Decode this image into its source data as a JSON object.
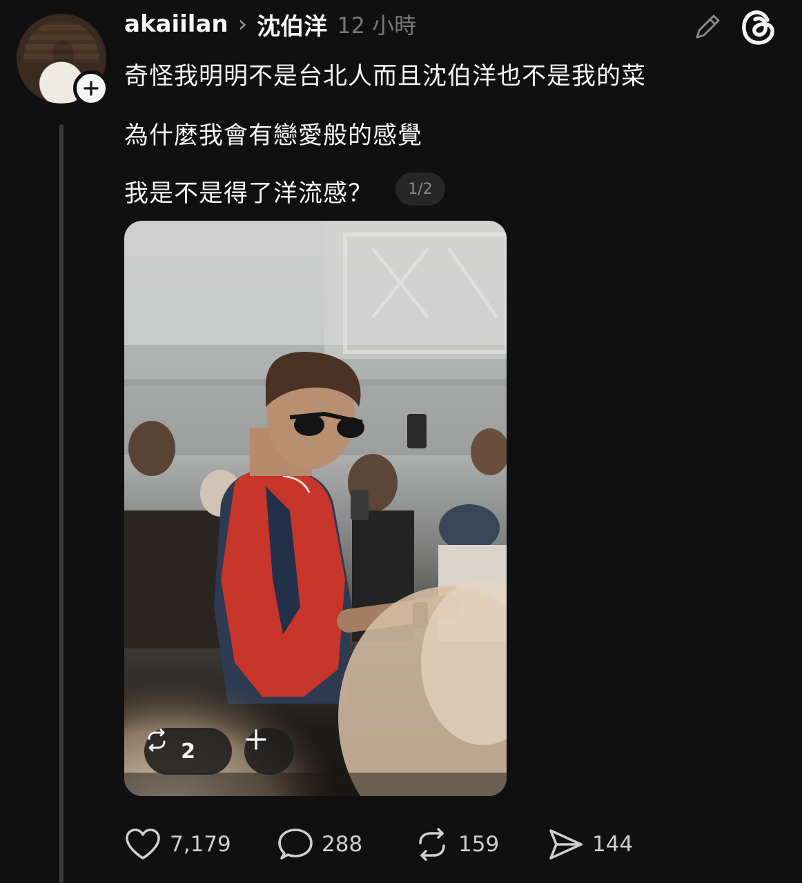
{
  "post": {
    "username": "akaiilan",
    "reply_chevron": "›",
    "reply_to": "沈伯洋",
    "time": "12 小時",
    "lines": [
      "奇怪我明明不是台北人而且沈伯洋也不是我的菜",
      "為什麼我會有戀愛般的感覺",
      "我是不是得了洋流感？"
    ],
    "page_indicator": "1/2"
  },
  "media": {
    "repost_count": "2",
    "repost_icon": "repost-icon",
    "add_icon": "plus-icon"
  },
  "actions": {
    "likes": "7,179",
    "replies": "288",
    "reposts": "159",
    "shares": "144"
  },
  "icons": {
    "edit": "pencil-icon",
    "logo": "threads-logo-icon",
    "follow": "plus-icon"
  },
  "colors": {
    "background": "#101010",
    "text": "#f3f5f7",
    "muted": "#777777",
    "vest": "#c8352a"
  }
}
